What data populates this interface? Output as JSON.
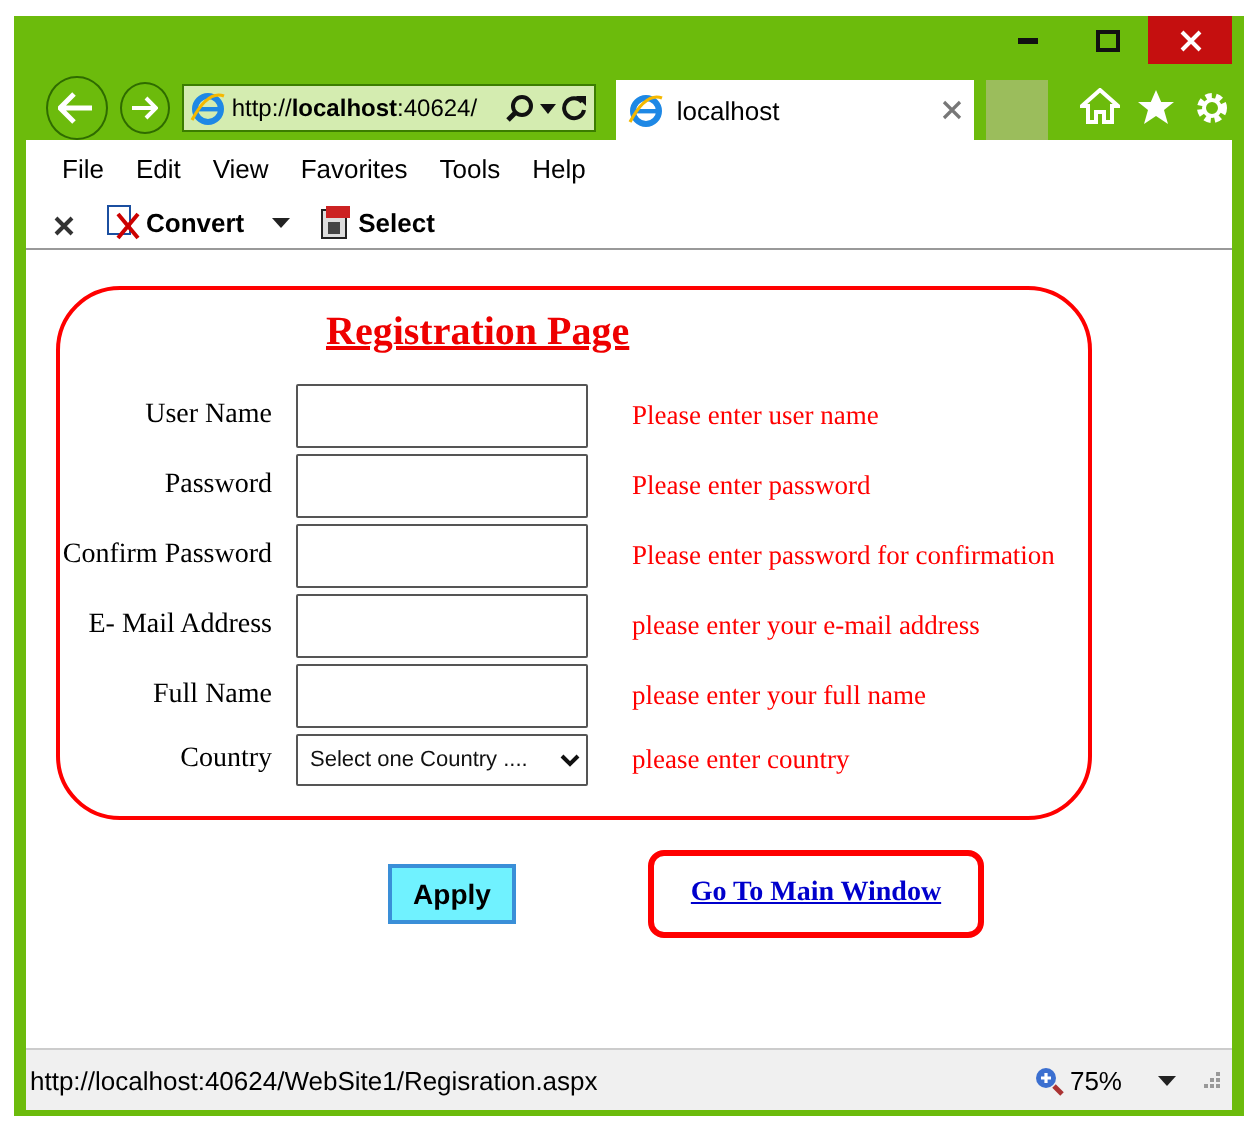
{
  "browser": {
    "address": "http://**localhost**:40624/",
    "tab": {
      "title": "localhost",
      "selected": true
    },
    "menu": [
      "File",
      "Edit",
      "View",
      "Favorites",
      "Tools",
      "Help"
    ],
    "toolbar": [
      {
        "kind": "close"
      },
      {
        "kind": "dropdown",
        "label": "Convert"
      },
      {
        "kind": "button",
        "label": "Select"
      }
    ]
  },
  "form": {
    "title": "Registration Page",
    "fields": [
      {
        "label": "User Name",
        "kind": "text",
        "message": "Please enter user name"
      },
      {
        "label": "Password",
        "kind": "text",
        "message": "Please enter password"
      },
      {
        "label": "Confirm Password",
        "kind": "text",
        "message": "Please enter password for confirmation"
      },
      {
        "label": "E- Mail Address",
        "kind": "text",
        "message": "please enter your e-mail address"
      },
      {
        "label": "Full Name",
        "kind": "text",
        "message": "please enter your full name"
      },
      {
        "label": "Country",
        "kind": "select",
        "value": "Select one Country ....",
        "message": "please enter country"
      }
    ],
    "apply_button": "Apply",
    "link": "Go To Main Window"
  },
  "status_bar": {
    "url": "http://localhost:40624/WebSite1/Regisration.aspx",
    "zoom": "75%"
  }
}
